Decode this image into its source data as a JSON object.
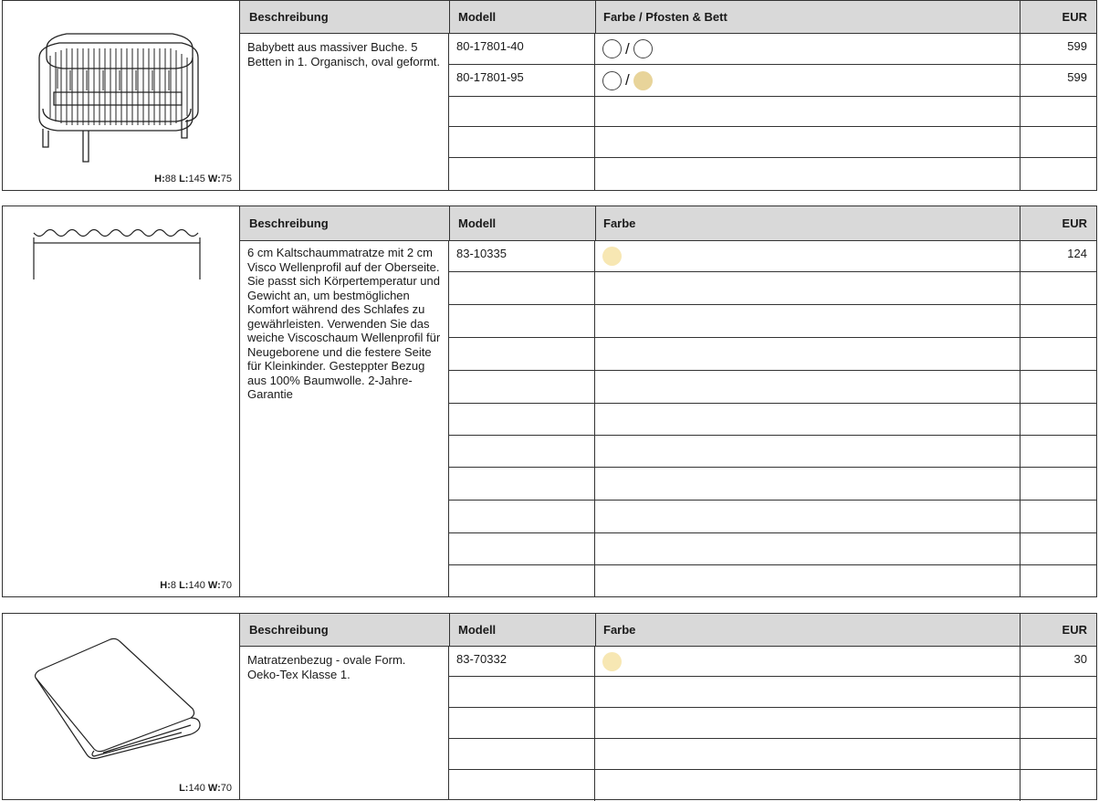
{
  "colors": {
    "natural_beech": "#e8d49a",
    "cream": "#f7e7b3",
    "white": "#ffffff",
    "header_bg": "#d9d9d9"
  },
  "blocks": [
    {
      "image_icon": "oval-crib-drawing",
      "dims": {
        "h_label": "H:",
        "h": "88",
        "l_label": "L:",
        "l": "145",
        "w_label": "W:",
        "w": "75"
      },
      "header": {
        "desc": "Beschreibung",
        "model": "Modell",
        "color": "Farbe / Pfosten & Bett",
        "eur": "EUR"
      },
      "description": "Babybett aus massiver Buche. 5 Betten in 1. Organisch, oval geformt.",
      "rows": [
        {
          "model": "80-17801-40",
          "swatches": [
            "white",
            "white"
          ],
          "price": "599"
        },
        {
          "model": "80-17801-95",
          "swatches": [
            "white",
            "natural_beech"
          ],
          "price": "599"
        },
        {
          "model": "",
          "swatches": [],
          "price": ""
        },
        {
          "model": "",
          "swatches": [],
          "price": ""
        },
        {
          "model": "",
          "swatches": [],
          "price": ""
        }
      ]
    },
    {
      "image_icon": "wave-mattress-drawing",
      "dims": {
        "h_label": "H:",
        "h": "8",
        "l_label": "L:",
        "l": "140",
        "w_label": "W:",
        "w": "70"
      },
      "header": {
        "desc": "Beschreibung",
        "model": "Modell",
        "color": "Farbe",
        "eur": "EUR"
      },
      "description": "6 cm Kaltschaummatratze mit 2 cm Visco Wellenprofil auf der Oberseite. Sie passt sich Körpertemperatur und Gewicht an, um bestmöglichen Komfort während des Schlafes zu gewährleisten. Verwenden Sie das weiche Viscoschaum Wellenprofil für Neugeborene und die  festere Seite für Kleinkinder. Gesteppter Bezug aus 100% Baumwolle. 2-Jahre-Garantie",
      "rows": [
        {
          "model": "83-10335",
          "swatches": [
            "cream"
          ],
          "price": "124"
        },
        {
          "model": "",
          "swatches": [],
          "price": ""
        },
        {
          "model": "",
          "swatches": [],
          "price": ""
        },
        {
          "model": "",
          "swatches": [],
          "price": ""
        },
        {
          "model": "",
          "swatches": [],
          "price": ""
        },
        {
          "model": "",
          "swatches": [],
          "price": ""
        },
        {
          "model": "",
          "swatches": [],
          "price": ""
        },
        {
          "model": "",
          "swatches": [],
          "price": ""
        },
        {
          "model": "",
          "swatches": [],
          "price": ""
        },
        {
          "model": "",
          "swatches": [],
          "price": ""
        },
        {
          "model": "",
          "swatches": [],
          "price": ""
        }
      ]
    },
    {
      "image_icon": "mattress-cover-drawing",
      "dims": {
        "h_label": "",
        "h": "",
        "l_label": "L:",
        "l": "140",
        "w_label": "W:",
        "w": "70"
      },
      "header": {
        "desc": "Beschreibung",
        "model": "Modell",
        "color": "Farbe",
        "eur": "EUR"
      },
      "description": "Matratzenbezug - ovale Form. Oeko-Tex Klasse 1.",
      "rows": [
        {
          "model": "83-70332",
          "swatches": [
            "cream"
          ],
          "price": "30"
        },
        {
          "model": "",
          "swatches": [],
          "price": ""
        },
        {
          "model": "",
          "swatches": [],
          "price": ""
        },
        {
          "model": "",
          "swatches": [],
          "price": ""
        },
        {
          "model": "",
          "swatches": [],
          "price": ""
        }
      ]
    }
  ]
}
